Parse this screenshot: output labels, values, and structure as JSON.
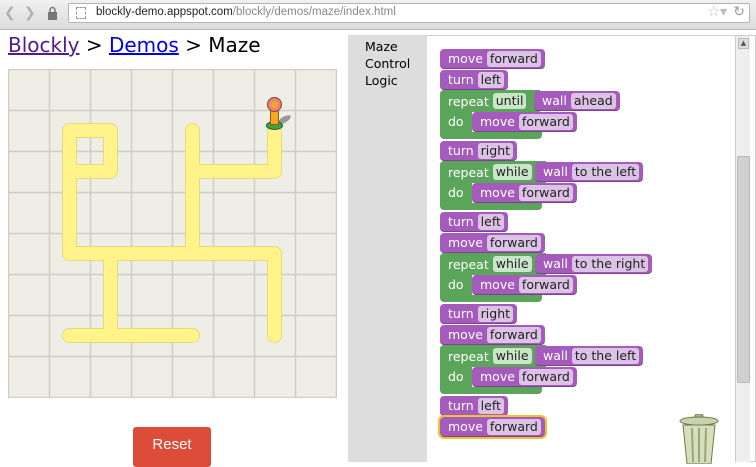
{
  "browser": {
    "url_host": "blockly-demo.appspot.com",
    "url_path": "/blockly/demos/maze/index.html"
  },
  "header": {
    "crumb1": "Blockly",
    "sep1": ">",
    "crumb2": "Demos",
    "sep2": ">",
    "current": "Maze"
  },
  "maze": {
    "columns": 8,
    "rows": 8,
    "path_color": "#fff389",
    "paths": [
      [
        [
          6,
          1
        ],
        [
          6,
          2
        ],
        [
          4,
          2
        ]
      ],
      [
        [
          4,
          1
        ],
        [
          4,
          4
        ]
      ],
      [
        [
          1,
          4
        ],
        [
          6,
          4
        ],
        [
          6,
          6
        ]
      ],
      [
        [
          1,
          4
        ],
        [
          1,
          1
        ],
        [
          2,
          1
        ],
        [
          2,
          2
        ],
        [
          1,
          2
        ]
      ],
      [
        [
          2,
          4
        ],
        [
          2,
          6
        ]
      ],
      [
        [
          1,
          6
        ],
        [
          4,
          6
        ]
      ]
    ],
    "pegman_cell": [
      6,
      1
    ]
  },
  "reset_label": "Reset",
  "toolbox": [
    "Maze",
    "Control",
    "Logic"
  ],
  "program": [
    {
      "type": "simple",
      "label": "move",
      "field": "forward"
    },
    {
      "type": "simple",
      "label": "turn",
      "field": "left"
    },
    {
      "type": "repeat",
      "label": "repeat",
      "mode": "until",
      "cond_label": "wall",
      "cond_field": "ahead",
      "do_label": "do",
      "body_label": "move",
      "body_field": "forward"
    },
    {
      "type": "simple",
      "label": "turn",
      "field": "right"
    },
    {
      "type": "repeat",
      "label": "repeat",
      "mode": "while",
      "cond_label": "wall",
      "cond_field": "to the left",
      "do_label": "do",
      "body_label": "move",
      "body_field": "forward"
    },
    {
      "type": "simple",
      "label": "turn",
      "field": "left"
    },
    {
      "type": "simple",
      "label": "move",
      "field": "forward"
    },
    {
      "type": "repeat",
      "label": "repeat",
      "mode": "while",
      "cond_label": "wall",
      "cond_field": "to the right",
      "do_label": "do",
      "body_label": "move",
      "body_field": "forward"
    },
    {
      "type": "simple",
      "label": "turn",
      "field": "right"
    },
    {
      "type": "simple",
      "label": "move",
      "field": "forward"
    },
    {
      "type": "repeat",
      "label": "repeat",
      "mode": "while",
      "cond_label": "wall",
      "cond_field": "to the left",
      "do_label": "do",
      "body_label": "move",
      "body_field": "forward"
    },
    {
      "type": "simple",
      "label": "turn",
      "field": "left"
    },
    {
      "type": "simple",
      "label": "move",
      "field": "forward",
      "selected": true
    }
  ],
  "colors": {
    "motion": "#a55bbb",
    "control": "#5ba55b",
    "reset": "#dd4b39"
  }
}
